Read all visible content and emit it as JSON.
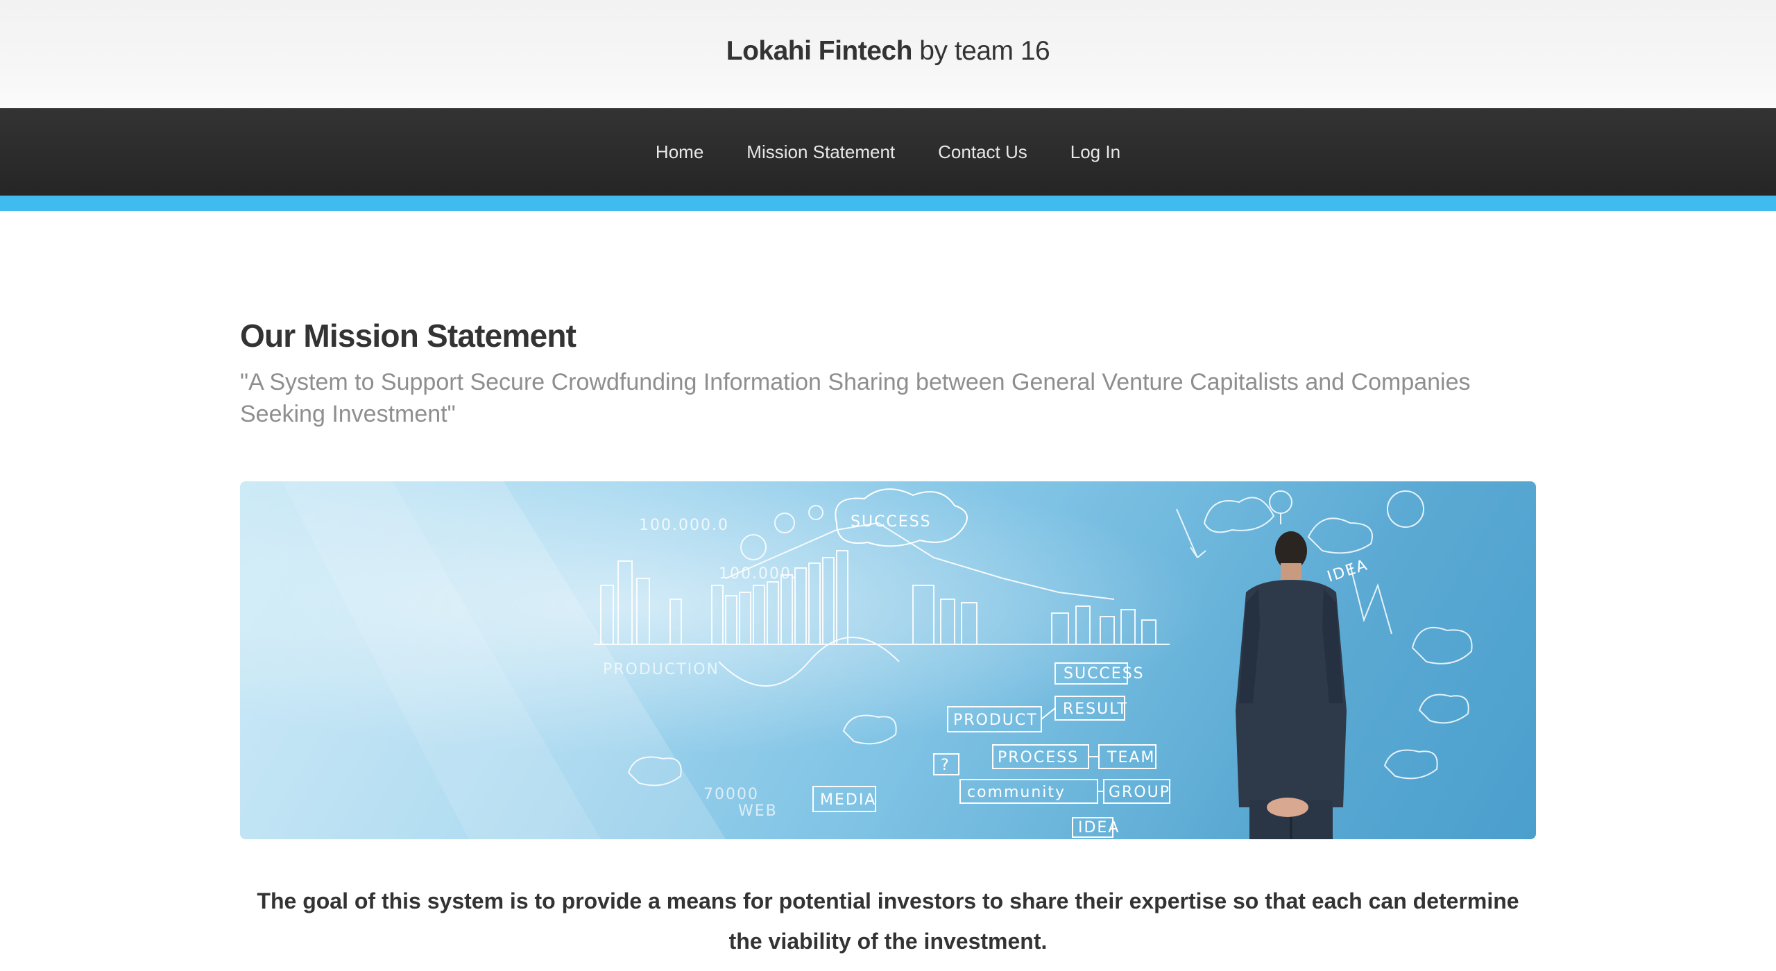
{
  "header": {
    "brand_name": "Lokahi Fintech",
    "brand_suffix": "by team 16"
  },
  "nav": {
    "items": [
      {
        "label": "Home"
      },
      {
        "label": "Mission Statement"
      },
      {
        "label": "Contact Us"
      },
      {
        "label": "Log In"
      }
    ]
  },
  "main": {
    "heading": "Our Mission Statement",
    "subtitle": "\"A System to Support Secure Crowdfunding Information Sharing between General Venture Capitalists and Companies Seeking Investment\"",
    "hero_words": {
      "success_top": "SUCCESS",
      "idea_right": "IDEA",
      "production": "PRODUCTION",
      "product": "PRODUCT",
      "success_box": "SUCCESS",
      "result": "RESULT",
      "process": "PROCESS",
      "team": "TEAM",
      "community": "community",
      "group": "GROUP",
      "media": "MEDIA",
      "idea_bottom": "IDEA",
      "web": "WEB",
      "num_top": "100.000.0",
      "num_mid": "100.000.",
      "num_low": "70000",
      "question": "?"
    },
    "goal_text": "The goal of this system is to provide a means for potential investors to share their expertise so that each can determine the viability of the investment."
  },
  "colors": {
    "nav_bg": "#2b2b2b",
    "accent": "#3fbbf0",
    "heading": "#333333",
    "subtitle": "#8e8e8e"
  }
}
